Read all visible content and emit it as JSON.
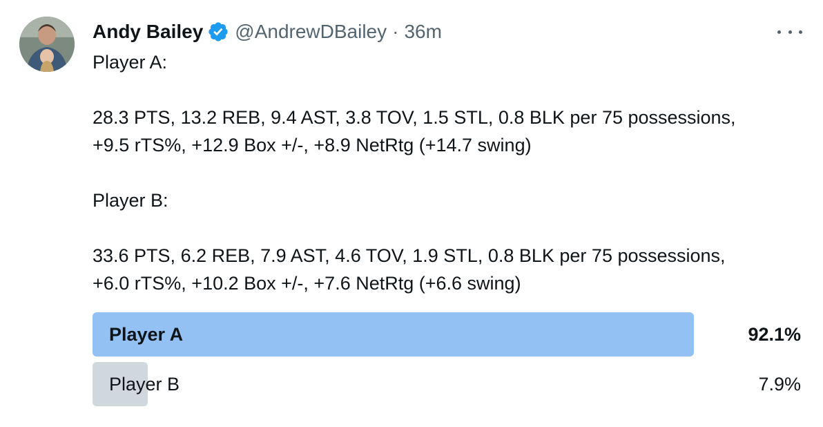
{
  "tweet": {
    "author_name": "Andy Bailey",
    "handle": "@AndrewDBailey",
    "separator": "·",
    "time": "36m",
    "verified_icon": "verified-badge-icon",
    "more_icon": "more-options-icon",
    "accent_color": "#1d9bf0",
    "lines": [
      "Player A:",
      "",
      "28.3 PTS, 13.2 REB, 9.4 AST, 3.8 TOV, 1.5 STL, 0.8 BLK per 75 possessions,",
      "+9.5 rTS%, +12.9 Box +/-, +8.9 NetRtg (+14.7 swing)",
      "",
      "Player B:",
      "",
      "33.6 PTS, 6.2 REB, 7.9 AST, 4.6 TOV, 1.9 STL, 0.8 BLK per 75 possessions,",
      "+6.0 rTS%, +10.2 Box +/-, +7.6 NetRtg (+6.6 swing)"
    ]
  },
  "poll": {
    "options": [
      {
        "label": "Player A",
        "percent_text": "92.1%",
        "fraction": 0.921,
        "winner": true,
        "color": "#93c1f3"
      },
      {
        "label": "Player B",
        "percent_text": "7.9%",
        "fraction": 0.079,
        "winner": false,
        "color": "#d1d8dd"
      }
    ]
  }
}
